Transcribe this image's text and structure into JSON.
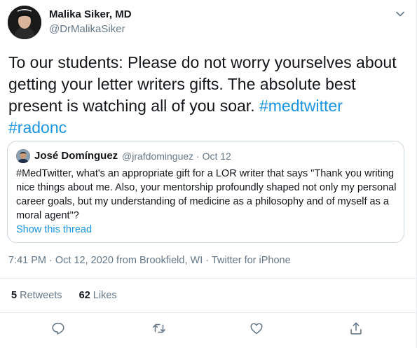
{
  "author": {
    "name": "Malika Siker, MD",
    "handle": "@DrMalikaSiker"
  },
  "tweet": {
    "text_plain": "To our students: Please do not worry yourselves about getting your letter writers gifts. The absolute best present is watching all of you soar. ",
    "hashtag1": "#medtwitter",
    "hashtag2": "#radonc"
  },
  "quoted": {
    "name": "José Domínguez",
    "meta": "@jrafdominguez · Oct 12",
    "text": "#MedTwitter, what's an appropriate gift for a LOR writer that says \"Thank you writing nice things about me. Also, your mentorship profoundly shaped not only my personal career goals, but my understanding of medicine as a philosophy and of myself as a moral agent\"?",
    "show_thread": "Show this thread"
  },
  "meta": {
    "time": "7:41 PM",
    "date": "Oct 12, 2020",
    "location": "from Brookfield, WI",
    "source": "Twitter for iPhone",
    "separator": " · "
  },
  "stats": {
    "retweets_count": "5",
    "retweets_label": "Retweets",
    "likes_count": "62",
    "likes_label": "Likes"
  },
  "colors": {
    "link": "#1b95e0",
    "secondary": "#657786",
    "divider": "#e6ecf0"
  },
  "icons": [
    "chevron-down-icon",
    "reply-icon",
    "retweet-icon",
    "like-icon",
    "share-icon"
  ]
}
